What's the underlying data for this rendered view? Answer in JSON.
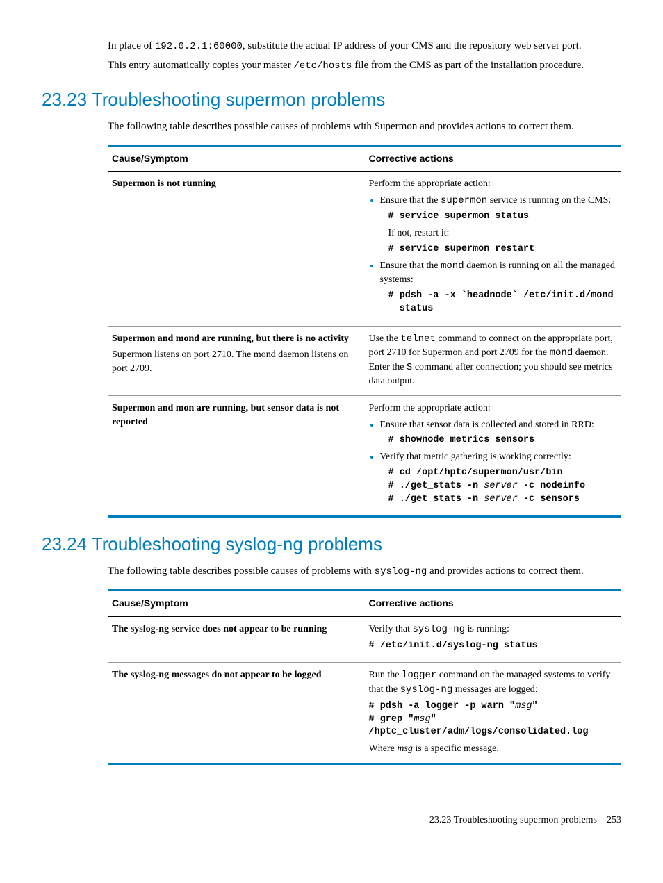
{
  "intro": {
    "p1_a": "In place of ",
    "p1_code": "192.0.2.1:60000",
    "p1_b": ", substitute the actual IP address of your CMS and the repository web server port.",
    "p2_a": "This entry automatically copies your master ",
    "p2_code": "/etc/hosts",
    "p2_b": " file from the CMS as part of the installation procedure."
  },
  "s1": {
    "heading": "23.23 Troubleshooting supermon problems",
    "lead": "The following table describes possible causes of problems with Supermon and provides actions to correct them.",
    "th1": "Cause/Symptom",
    "th2": "Corrective actions",
    "r1": {
      "cause": "Supermon is not running",
      "act_pre": "Perform the appropriate action:",
      "b1_a": "Ensure that the ",
      "b1_code": "supermon",
      "b1_b": " service is running on the CMS:",
      "cmd1": "# service supermon status",
      "b1_c": "If not, restart it:",
      "cmd2": "# service supermon restart",
      "b2_a": "Ensure that the ",
      "b2_code": "mond",
      "b2_b": " daemon is running on all the managed systems:",
      "cmd3": "# pdsh -a -x `headnode` /etc/init.d/mond\n  status"
    },
    "r2": {
      "cause_bold": "Supermon and mond are running, but there is no activity",
      "cause_rest": "Supermon listens on port 2710. The mond daemon listens on port 2709.",
      "act_a": "Use the ",
      "act_code1": "telnet",
      "act_b": " command to connect on the appropriate port, port 2710 for Supermon and port 2709 for the ",
      "act_code2": "mond",
      "act_c": " daemon. Enter the ",
      "act_code3": "S",
      "act_d": " command after connection; you should see metrics data output."
    },
    "r3": {
      "cause_bold": "Supermon and mon are running, but sensor data is not reported",
      "act_pre": "Perform the appropriate action:",
      "b1": "Ensure that sensor data is collected and stored in RRD:",
      "cmd1": "# shownode metrics sensors",
      "b2": "Verify that metric gathering is working correctly:",
      "cmd2_a": "# cd /opt/hptc/supermon/usr/bin\n# ./get_stats -n ",
      "cmd2_srv1": "server",
      "cmd2_b": " -c nodeinfo\n# ./get_stats -n ",
      "cmd2_srv2": "server",
      "cmd2_c": " -c sensors"
    }
  },
  "s2": {
    "heading": "23.24 Troubleshooting syslog-ng problems",
    "lead_a": "The following table describes possible causes of problems with ",
    "lead_code": "syslog-ng",
    "lead_b": " and provides actions to correct them.",
    "th1": "Cause/Symptom",
    "th2": "Corrective actions",
    "r1": {
      "cause": "The syslog-ng service does not appear to be running",
      "act_a": "Verify that ",
      "act_code": "syslog-ng",
      "act_b": " is running:",
      "cmd1": "# /etc/init.d/syslog-ng status"
    },
    "r2": {
      "cause": "The syslog-ng messages do not appear to be logged",
      "act_a": "Run the ",
      "act_code1": "logger",
      "act_b": " command on the managed systems to verify that the ",
      "act_code2": "syslog-ng",
      "act_c": " messages are logged:",
      "cmd_a": "# pdsh -a logger -p warn \"",
      "cmd_msg1": "msg",
      "cmd_b": "\"\n# grep \"",
      "cmd_msg2": "msg",
      "cmd_c": "\"\n/hptc_cluster/adm/logs/consolidated.log",
      "act_d_pre": "Where ",
      "act_d_it": "msg",
      "act_d_post": " is a specific message."
    }
  },
  "footer": {
    "section": "23.23 Troubleshooting supermon problems",
    "page": "253"
  }
}
